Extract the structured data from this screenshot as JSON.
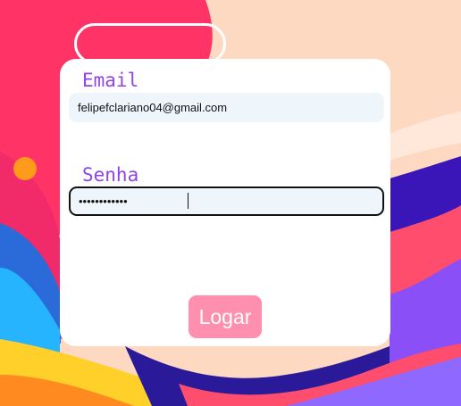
{
  "colors": {
    "background": "#fdd9c2",
    "label_color": "#8e44e8",
    "input_background": "#eef6fc",
    "button_color": "#ff8fae",
    "card_color": "#ffffff"
  },
  "login_form": {
    "email_label": "Email",
    "email_value": "felipefclariano04@gmail.com",
    "password_label": "Senha",
    "password_value": "••••••••••••",
    "submit_label": "Logar"
  }
}
